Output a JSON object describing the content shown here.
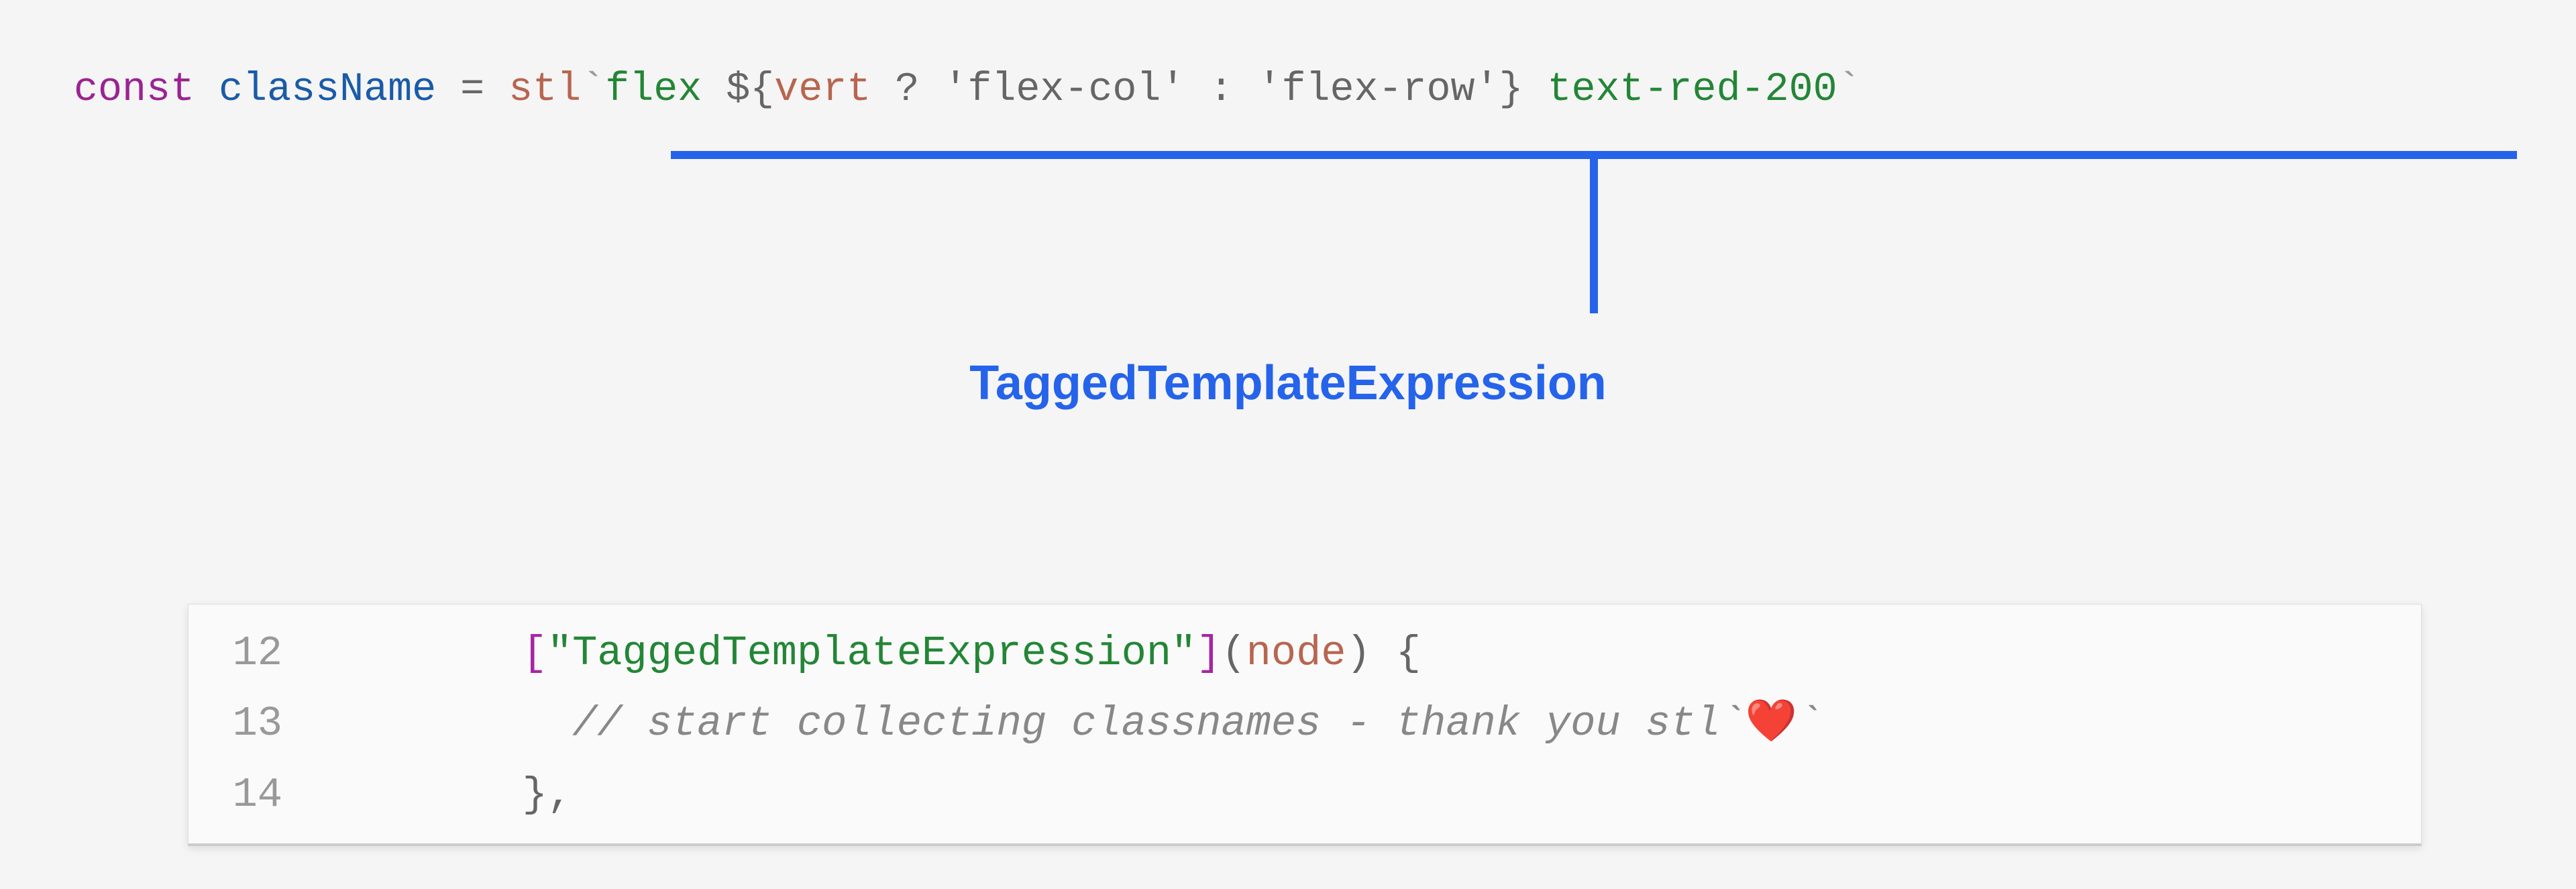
{
  "top_code": {
    "const": "const",
    "ident": "className",
    "eq": "=",
    "tag": "stl",
    "pre_str": "flex ",
    "dollar": "${",
    "var": "vert",
    "q": "?",
    "opt1": "'flex-col'",
    "colon": ":",
    "opt2": "'flex-row'",
    "close": "}",
    "post_str": " text-red-200",
    "bt": "`"
  },
  "label": "TaggedTemplateExpression",
  "snippet": {
    "lines": [
      {
        "no": "12",
        "indent": "        ",
        "bracket_open": "[",
        "str": "\"TaggedTemplateExpression\"",
        "bracket_close": "]",
        "paren_open": "(",
        "node": "node",
        "paren_close": ")",
        "brace_open": " {"
      },
      {
        "no": "13",
        "indent": "          ",
        "comment_pre": "// start collecting classnames - thank you stl`",
        "heart": "❤️",
        "comment_post": "`"
      },
      {
        "no": "14",
        "indent": "        ",
        "brace_close": "},"
      }
    ]
  }
}
